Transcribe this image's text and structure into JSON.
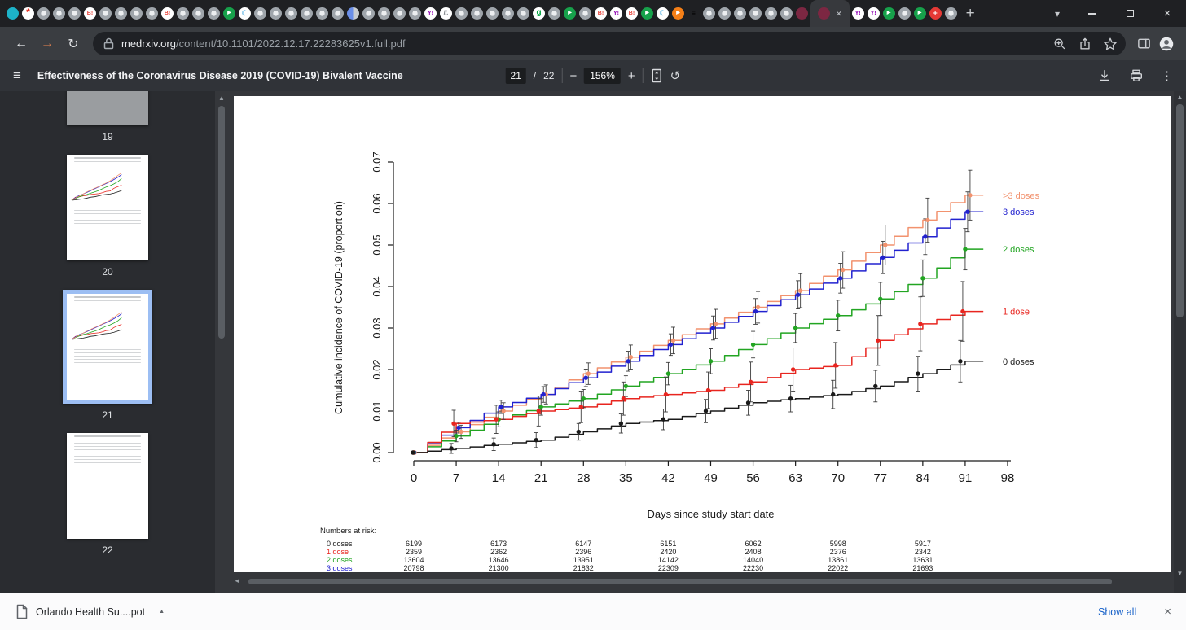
{
  "glyphs": {
    "back": "←",
    "forward": "→",
    "reload": "↻",
    "close_tab": "×",
    "new_tab": "+",
    "tab_search": "▾",
    "window_close": "×",
    "close_small": "×",
    "menu": "≡",
    "more": "⋮",
    "zoom_out": "−",
    "zoom_in": "+",
    "rotate": "↺",
    "up": "▲",
    "down": "▼",
    "left": "◄",
    "caret_up": "▲"
  },
  "browser": {
    "tabs": {
      "pinned": [
        "globe",
        "star-red",
        "disc",
        "disc",
        "disc",
        "hatena",
        "disc",
        "disc",
        "disc",
        "disc",
        "hatena",
        "disc",
        "disc",
        "disc",
        "play-green",
        "crescent",
        "disc",
        "disc",
        "disc",
        "disc",
        "disc",
        "disc",
        "half-blue",
        "disc",
        "disc",
        "disc",
        "disc",
        "yahoo",
        "stats",
        "disc",
        "disc",
        "disc",
        "disc",
        "disc",
        "goo",
        "disc",
        "play-green",
        "disc",
        "hatena",
        "yahoo",
        "hatena",
        "play-green",
        "crescent",
        "play-orange",
        "menu-orange",
        "disc",
        "disc",
        "disc",
        "disc",
        "disc",
        "disc",
        "maroon"
      ],
      "active_icon": "maroon",
      "after": [
        "yahoo",
        "yahoo",
        "play-green",
        "disc",
        "play-green",
        "med-red",
        "disc"
      ],
      "icon_glyphs": {
        "hatena": "B!",
        "yahoo": "Y!",
        "goo": "g",
        "stats": "ll.",
        "crescent": "☾",
        "menu-orange": "≡",
        "star-red": "*",
        "med-red": "+",
        "play-green": "▶",
        "play-orange": "▶"
      }
    },
    "address": {
      "domain": "medrxiv.org",
      "path": "/content/10.1101/2022.12.17.22283625v1.full.pdf"
    }
  },
  "pdf_toolbar": {
    "title": "Effectiveness of the Coronavirus Disease 2019 (COVID-19) Bivalent Vaccine",
    "page_current": "21",
    "page_separator": "/",
    "page_total": "22",
    "zoom_level": "156%"
  },
  "sidebar": {
    "thumbnails": [
      {
        "page": "19",
        "style": "plain",
        "selected": false
      },
      {
        "page": "20",
        "style": "chart",
        "selected": false
      },
      {
        "page": "21",
        "style": "chart",
        "selected": true
      },
      {
        "page": "22",
        "style": "text",
        "selected": false
      }
    ]
  },
  "downloads_bar": {
    "file_name": "Orlando Health Su....pot",
    "show_all_label": "Show all"
  },
  "chart_data": {
    "type": "line",
    "subtype": "step-cumulative-incidence",
    "title": "",
    "xlabel": "Days since study start date",
    "ylabel": "Cumulative incidence of COVID-19 (proportion)",
    "xlim": [
      0,
      98
    ],
    "ylim": [
      0,
      0.07
    ],
    "xticks": [
      0,
      7,
      14,
      21,
      28,
      35,
      42,
      49,
      56,
      63,
      70,
      77,
      84,
      91,
      98
    ],
    "yticks": [
      0.0,
      0.01,
      0.02,
      0.03,
      0.04,
      0.05,
      0.06,
      0.07
    ],
    "grid": false,
    "legend_position": "right-margin",
    "days": [
      0,
      7,
      14,
      21,
      28,
      35,
      42,
      49,
      56,
      63,
      70,
      77,
      84,
      91
    ],
    "series": [
      {
        "name": "0 doses",
        "color": "#1a1a1a",
        "values": [
          0,
          0.001,
          0.002,
          0.003,
          0.005,
          0.007,
          0.008,
          0.01,
          0.012,
          0.013,
          0.014,
          0.016,
          0.019,
          0.022
        ],
        "ci": [
          0.0012,
          0.0015,
          0.0018,
          0.002,
          0.0023,
          0.0025,
          0.0028,
          0.003,
          0.0032,
          0.0034,
          0.0038,
          0.0042,
          0.005
        ]
      },
      {
        "name": "1 dose",
        "color": "#e8251f",
        "values": [
          0,
          0.007,
          0.008,
          0.01,
          0.011,
          0.013,
          0.014,
          0.015,
          0.017,
          0.02,
          0.021,
          0.027,
          0.031,
          0.034
        ],
        "ci": [
          0.0032,
          0.0034,
          0.0036,
          0.0038,
          0.004,
          0.0042,
          0.0044,
          0.0048,
          0.0052,
          0.0055,
          0.006,
          0.0065,
          0.0072
        ]
      },
      {
        "name": "2 doses",
        "color": "#22a522",
        "values": [
          0,
          0.004,
          0.008,
          0.011,
          0.013,
          0.016,
          0.019,
          0.022,
          0.026,
          0.03,
          0.033,
          0.037,
          0.042,
          0.049
        ],
        "ci": [
          0.0014,
          0.0018,
          0.002,
          0.0022,
          0.0025,
          0.0027,
          0.003,
          0.0032,
          0.0035,
          0.0037,
          0.004,
          0.0044,
          0.005
        ]
      },
      {
        "name": "3 doses",
        "color": "#2222cf",
        "values": [
          0,
          0.006,
          0.011,
          0.014,
          0.018,
          0.022,
          0.026,
          0.03,
          0.034,
          0.038,
          0.042,
          0.047,
          0.052,
          0.058
        ],
        "ci": [
          0.0013,
          0.0016,
          0.0019,
          0.0021,
          0.0024,
          0.0026,
          0.0029,
          0.0031,
          0.0034,
          0.0036,
          0.0039,
          0.0043,
          0.0048
        ]
      },
      {
        "name": ">3 doses",
        "color": "#f2926e",
        "values": [
          0,
          0.005,
          0.01,
          0.014,
          0.019,
          0.023,
          0.027,
          0.031,
          0.035,
          0.039,
          0.044,
          0.05,
          0.056,
          0.062
        ],
        "ci": [
          0.0016,
          0.002,
          0.0023,
          0.0026,
          0.0029,
          0.0032,
          0.0035,
          0.0038,
          0.0041,
          0.0044,
          0.0048,
          0.0053,
          0.006
        ]
      }
    ],
    "numbers_at_risk": {
      "label": "Numbers at risk:",
      "days": [
        0,
        14,
        28,
        42,
        56,
        70,
        84
      ],
      "rows": [
        {
          "name": "0 doses",
          "color": "#1a1a1a",
          "values": [
            "6199",
            "6173",
            "6147",
            "6151",
            "6062",
            "5998",
            "5917"
          ]
        },
        {
          "name": "1 dose",
          "color": "#e8251f",
          "values": [
            "2359",
            "2362",
            "2396",
            "2420",
            "2408",
            "2376",
            "2342"
          ]
        },
        {
          "name": "2 doses",
          "color": "#22a522",
          "values": [
            "13604",
            "13646",
            "13951",
            "14142",
            "14040",
            "13861",
            "13631"
          ]
        },
        {
          "name": "3 doses",
          "color": "#2222cf",
          "values": [
            "20798",
            "21300",
            "21832",
            "22309",
            "22230",
            "22022",
            "21693"
          ]
        }
      ]
    }
  }
}
